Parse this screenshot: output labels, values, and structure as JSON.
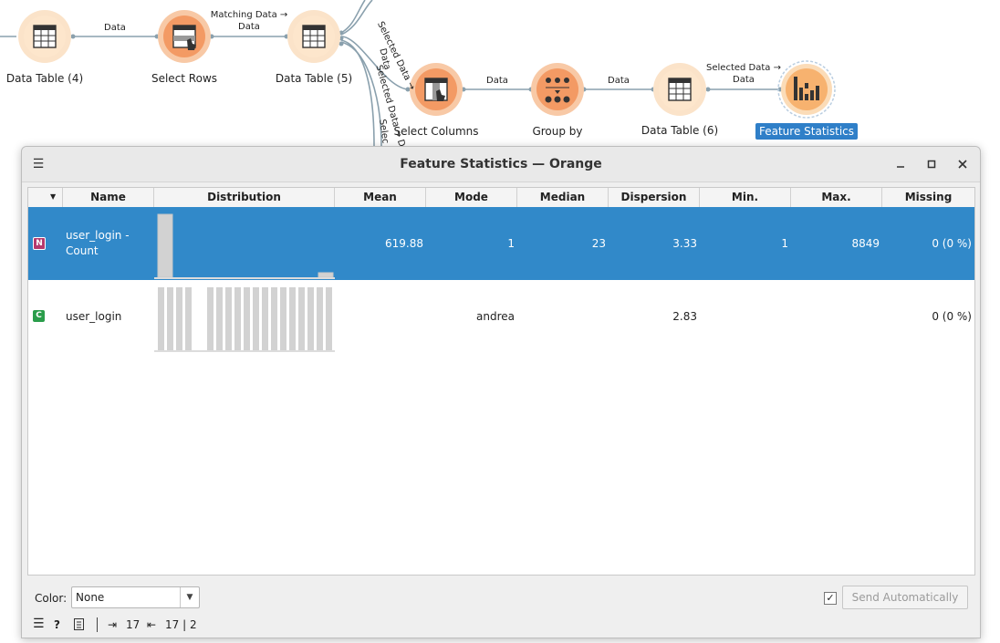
{
  "workflow": {
    "nodes": [
      {
        "label": "Data Table (4)",
        "icon": "table-icon"
      },
      {
        "label": "Select Rows",
        "icon": "select-rows-icon"
      },
      {
        "label": "Data Table (5)",
        "icon": "table-icon"
      },
      {
        "label": "Select Columns",
        "icon": "select-columns-icon"
      },
      {
        "label": "Group by",
        "icon": "group-by-icon"
      },
      {
        "label": "Data Table (6)",
        "icon": "table-icon"
      },
      {
        "label": "Feature Statistics",
        "icon": "feature-statistics-icon",
        "selected": true
      }
    ],
    "links": {
      "l1": "Data",
      "l2a": "Matching Data →",
      "l2b": "Data",
      "l3": "Data",
      "l4": "Data",
      "l5a": "Selected Data →",
      "l5b": "Data",
      "rot1": "Selected Data →",
      "rot2": "Data",
      "rot3": "Selected Data → Da",
      "rot4": "Selec"
    }
  },
  "window": {
    "title": "Feature Statistics — Orange",
    "menu_icon": "hamburger-icon",
    "controls": {
      "minimize": "minimize-icon",
      "maximize": "maximize-icon",
      "close": "close-icon"
    }
  },
  "table": {
    "columns": [
      "Name",
      "Distribution",
      "Mean",
      "Mode",
      "Median",
      "Dispersion",
      "Min.",
      "Max.",
      "Missing"
    ],
    "rows": [
      {
        "type_badge": "N",
        "type_color": "#b53a6d",
        "name_line1": "user_login -",
        "name_line2": "Count",
        "mean": "619.88",
        "mode": "1",
        "median": "23",
        "dispersion": "3.33",
        "min": "1",
        "max": "8849",
        "missing": "0 (0 %)",
        "selected": true
      },
      {
        "type_badge": "C",
        "type_color": "#2a9d4b",
        "name_line1": "user_login",
        "name_line2": "",
        "mean": "",
        "mode": "andrea",
        "median": "",
        "dispersion": "2.83",
        "min": "",
        "max": "",
        "missing": "0 (0 %)",
        "selected": false
      }
    ]
  },
  "controls": {
    "color_label": "Color:",
    "color_value": "None",
    "send_auto_checked": true,
    "send_auto_label": "Send Automatically"
  },
  "status": {
    "input_count": "17",
    "output_count": "17 | 2"
  },
  "colors": {
    "selection": "#3189c9",
    "node_fill": "#f6a36a",
    "node_ring": "#fbe3c9"
  }
}
